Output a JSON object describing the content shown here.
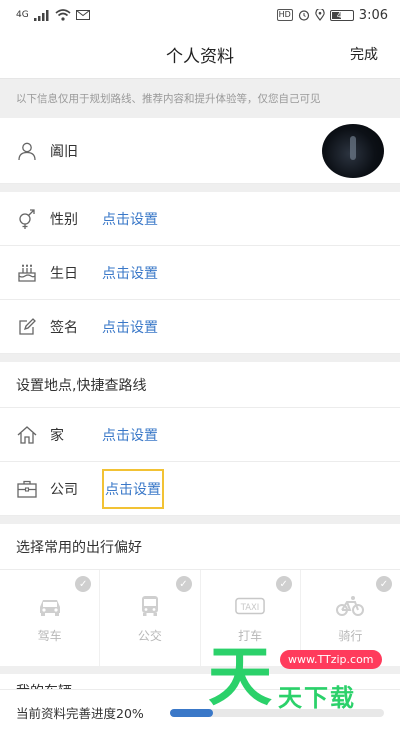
{
  "status_bar": {
    "time": "3:06",
    "signal": "4G",
    "battery": "41"
  },
  "header": {
    "title": "个人资料",
    "action": "完成"
  },
  "notice": "以下信息仅用于规划路线、推荐内容和提升体验等，仅您自己可见",
  "profile": {
    "name": "阖旧"
  },
  "basic_info": [
    {
      "label": "性别",
      "value": "点击设置",
      "icon": "gender-icon"
    },
    {
      "label": "生日",
      "value": "点击设置",
      "icon": "cake-icon"
    },
    {
      "label": "签名",
      "value": "点击设置",
      "icon": "edit-icon"
    }
  ],
  "places": {
    "title": "设置地点,快捷查路线",
    "items": [
      {
        "label": "家",
        "value": "点击设置",
        "icon": "home-icon"
      },
      {
        "label": "公司",
        "value": "点击设置",
        "icon": "briefcase-icon"
      }
    ]
  },
  "travel": {
    "title": "选择常用的出行偏好",
    "items": [
      {
        "label": "驾车",
        "icon": "car-icon"
      },
      {
        "label": "公交",
        "icon": "bus-icon"
      },
      {
        "label": "打车",
        "icon": "taxi-icon"
      },
      {
        "label": "骑行",
        "icon": "bike-icon"
      }
    ]
  },
  "next_section_title": "我的车辆",
  "progress": {
    "text": "当前资料完善进度20%",
    "value": 20,
    "color": "#3a78c8"
  },
  "watermark": {
    "pill": "www.TTzip.com",
    "text": "天下载",
    "big": "天"
  }
}
